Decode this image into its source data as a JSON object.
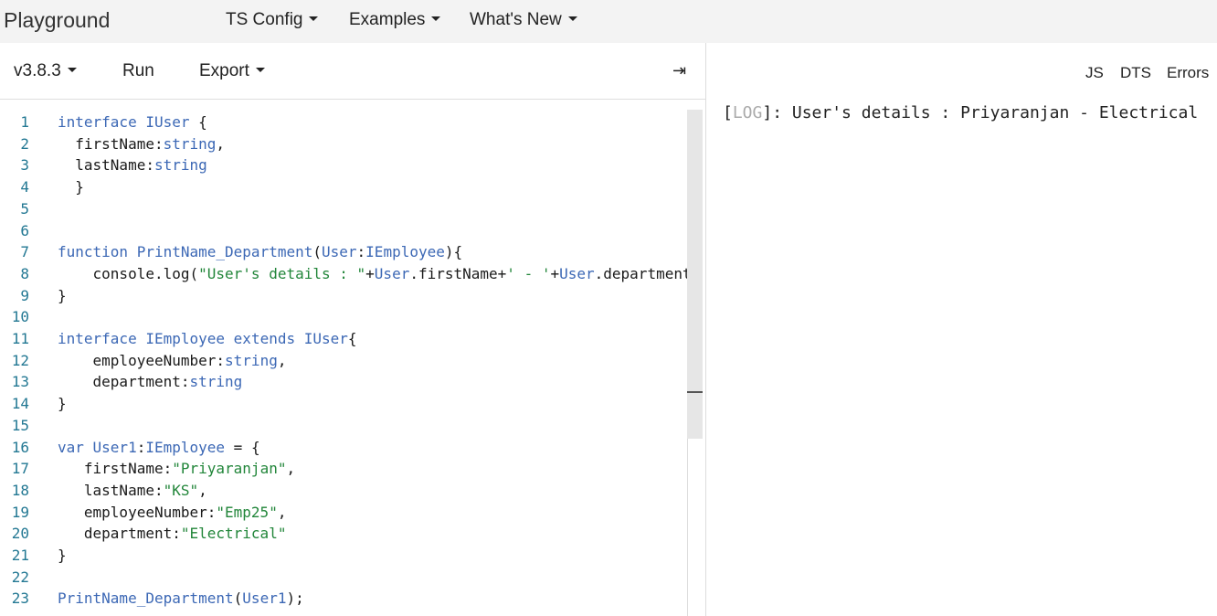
{
  "nav": {
    "brand": "Playground",
    "items": [
      "TS Config",
      "Examples",
      "What's New"
    ]
  },
  "toolbar": {
    "version": "v3.8.3",
    "run": "Run",
    "export": "Export",
    "collapse_glyph": "⇥"
  },
  "output": {
    "tabs": [
      "JS",
      "DTS",
      "Errors"
    ],
    "log_open": "[",
    "log_tag": "LOG",
    "log_close": "]",
    "log_message": ": User's details : Priyaranjan - Electrical"
  },
  "code_lines": [
    {
      "n": "1",
      "tokens": [
        {
          "t": "interface ",
          "c": "kw2"
        },
        {
          "t": "IUser",
          "c": "kw2"
        },
        {
          "t": " {"
        }
      ]
    },
    {
      "n": "2",
      "tokens": [
        {
          "t": "  firstName:"
        },
        {
          "t": "string",
          "c": "kw2"
        },
        {
          "t": ","
        }
      ]
    },
    {
      "n": "3",
      "tokens": [
        {
          "t": "  lastName:"
        },
        {
          "t": "string",
          "c": "kw2"
        }
      ]
    },
    {
      "n": "4",
      "tokens": [
        {
          "t": "  }"
        }
      ]
    },
    {
      "n": "5",
      "tokens": []
    },
    {
      "n": "6",
      "tokens": []
    },
    {
      "n": "7",
      "tokens": [
        {
          "t": "function ",
          "c": "kw2"
        },
        {
          "t": "PrintName_Department",
          "c": "kw2"
        },
        {
          "t": "("
        },
        {
          "t": "User",
          "c": "kw2"
        },
        {
          "t": ":"
        },
        {
          "t": "IEmployee",
          "c": "kw2"
        },
        {
          "t": "){"
        }
      ]
    },
    {
      "n": "8",
      "tokens": [
        {
          "t": "    console.log("
        },
        {
          "t": "\"User's details : \"",
          "c": "str"
        },
        {
          "t": "+"
        },
        {
          "t": "User",
          "c": "kw2"
        },
        {
          "t": ".firstName+"
        },
        {
          "t": "' - '",
          "c": "str"
        },
        {
          "t": "+"
        },
        {
          "t": "User",
          "c": "kw2"
        },
        {
          "t": ".department)"
        }
      ]
    },
    {
      "n": "9",
      "tokens": [
        {
          "t": "}"
        }
      ]
    },
    {
      "n": "10",
      "tokens": []
    },
    {
      "n": "11",
      "tokens": [
        {
          "t": "interface ",
          "c": "kw2"
        },
        {
          "t": "IEmployee",
          "c": "kw2"
        },
        {
          "t": " "
        },
        {
          "t": "extends",
          "c": "kw2"
        },
        {
          "t": " "
        },
        {
          "t": "IUser",
          "c": "kw2"
        },
        {
          "t": "{"
        }
      ]
    },
    {
      "n": "12",
      "tokens": [
        {
          "t": "    employeeNumber:"
        },
        {
          "t": "string",
          "c": "kw2"
        },
        {
          "t": ","
        }
      ]
    },
    {
      "n": "13",
      "tokens": [
        {
          "t": "    department:"
        },
        {
          "t": "string",
          "c": "kw2"
        }
      ]
    },
    {
      "n": "14",
      "tokens": [
        {
          "t": "}"
        }
      ]
    },
    {
      "n": "15",
      "tokens": []
    },
    {
      "n": "16",
      "tokens": [
        {
          "t": "var ",
          "c": "kw2"
        },
        {
          "t": "User1",
          "c": "kw2"
        },
        {
          "t": ":"
        },
        {
          "t": "IEmployee",
          "c": "kw2"
        },
        {
          "t": " = {"
        }
      ]
    },
    {
      "n": "17",
      "tokens": [
        {
          "t": "   firstName:"
        },
        {
          "t": "\"Priyaranjan\"",
          "c": "str"
        },
        {
          "t": ","
        }
      ]
    },
    {
      "n": "18",
      "tokens": [
        {
          "t": "   lastName:"
        },
        {
          "t": "\"KS\"",
          "c": "str"
        },
        {
          "t": ","
        }
      ]
    },
    {
      "n": "19",
      "tokens": [
        {
          "t": "   employeeNumber:"
        },
        {
          "t": "\"Emp25\"",
          "c": "str"
        },
        {
          "t": ","
        }
      ]
    },
    {
      "n": "20",
      "tokens": [
        {
          "t": "   department:"
        },
        {
          "t": "\"Electrical\"",
          "c": "str"
        }
      ]
    },
    {
      "n": "21",
      "tokens": [
        {
          "t": "}"
        }
      ]
    },
    {
      "n": "22",
      "tokens": []
    },
    {
      "n": "23",
      "tokens": [
        {
          "t": "PrintName_Department",
          "c": "kw2"
        },
        {
          "t": "("
        },
        {
          "t": "User1",
          "c": "kw2"
        },
        {
          "t": ");"
        }
      ]
    }
  ]
}
